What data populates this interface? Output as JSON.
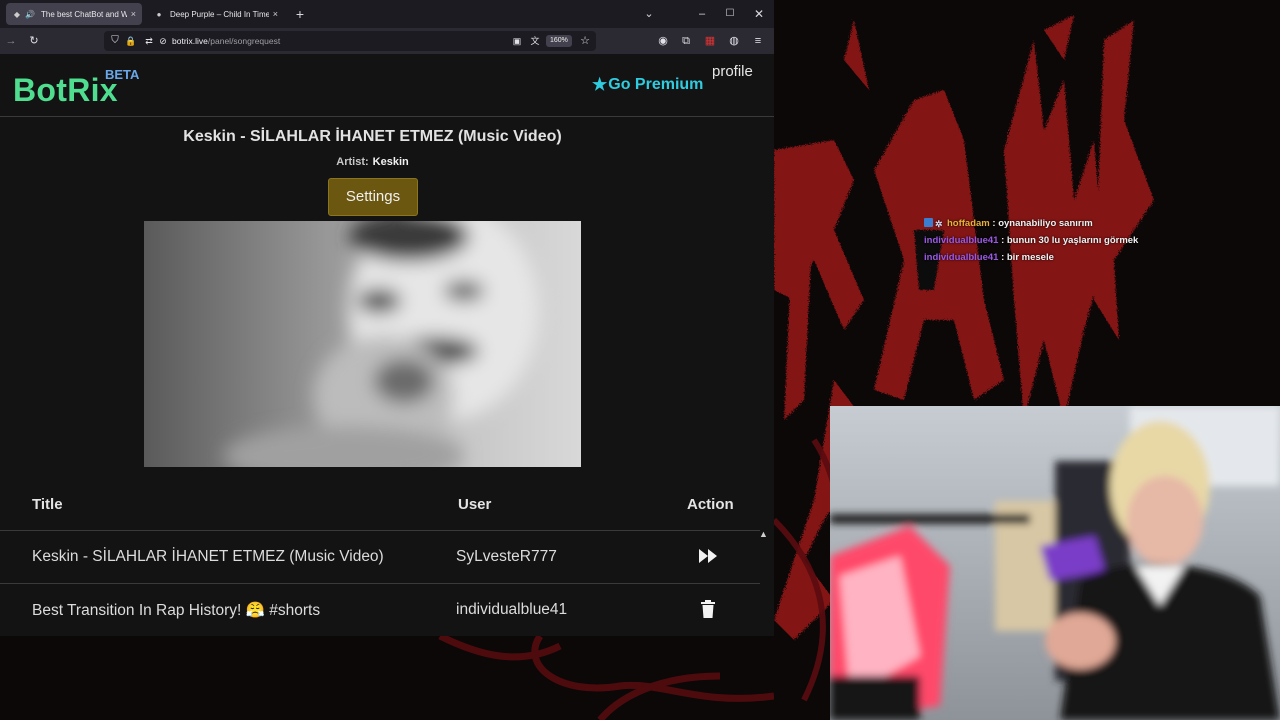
{
  "browser": {
    "tabs": [
      {
        "label": "The best ChatBot and Widg",
        "active": true
      },
      {
        "label": "Deep Purple – Child In Time – Y",
        "active": false
      }
    ],
    "url_host": "botrix.live",
    "url_path": "/panel/songrequest",
    "zoom": "160%",
    "tab_close_glyph": "×",
    "new_tab_glyph": "+"
  },
  "header": {
    "logo": "BotRix",
    "logo_badge": "BETA",
    "premium_label": "Go Premium",
    "profile_label": "profile"
  },
  "now_playing": {
    "title": "Keskin - SİLAHLAR İHANET ETMEZ (Music Video)",
    "artist_label": "Artist:",
    "artist": "Keskin",
    "settings_label": "Settings"
  },
  "queue": {
    "columns": [
      "Title",
      "User",
      "Action"
    ],
    "rows": [
      {
        "title": "Keskin - SİLAHLAR İHANET ETMEZ (Music Video)",
        "user": "SyLvesteR777",
        "action": "skip"
      },
      {
        "title": "Best Transition In Rap History! 😤 #shorts",
        "user": "individualblue41",
        "action": "delete"
      }
    ]
  },
  "chat": [
    {
      "user": "hoffadam",
      "message": ": oynanabiliyo sanırım",
      "color": "#e8b23a"
    },
    {
      "user": "individualblue41",
      "message": ": bunun 30 lu yaşlarını görmek",
      "color": "#9b59e6"
    },
    {
      "user": "individualblue41",
      "message": ": bir mesele",
      "color": "#9b59e6"
    }
  ],
  "colors": {
    "logo": "#4fde8f",
    "premium": "#2fcce0",
    "settings_button": "#6b5710",
    "stream_art": "#8a1418"
  }
}
